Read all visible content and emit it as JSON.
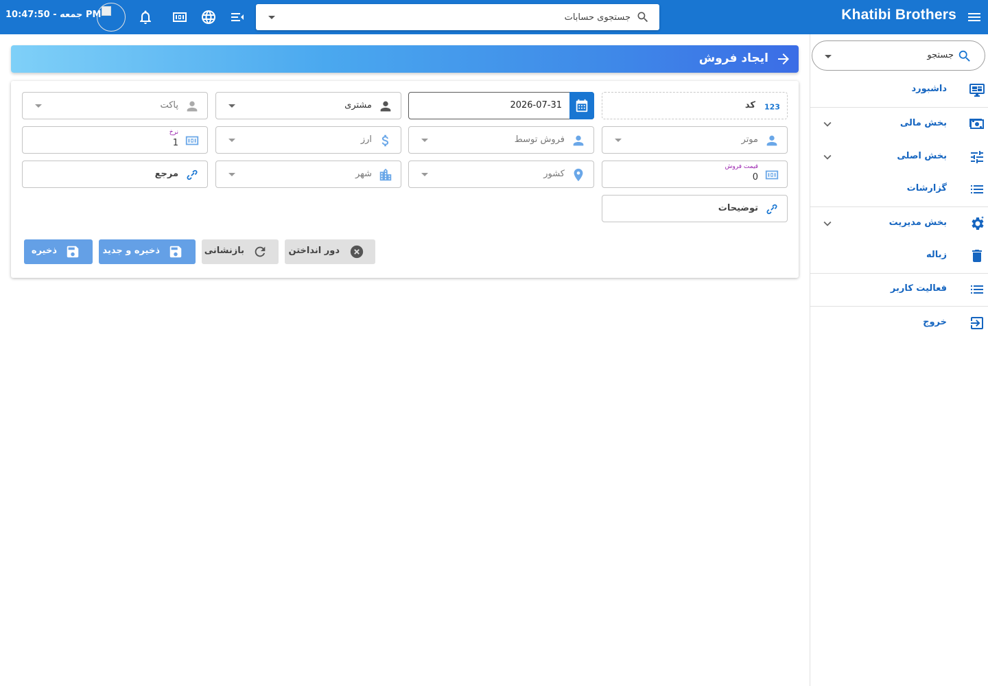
{
  "topbar": {
    "brand": "Khatibi Brothers",
    "search_placeholder": "جستجوی حسابات",
    "clock": "جمعه - 10:47:50 PM"
  },
  "sidebar": {
    "search_label": "جستجو",
    "items": [
      {
        "label": "داشبورد",
        "icon": "monitor-dashboard-icon",
        "expandable": false
      },
      {
        "label": "بخش مالی",
        "icon": "cash-icon",
        "expandable": true
      },
      {
        "label": "بخش اصلی",
        "icon": "tune-icon",
        "expandable": true
      },
      {
        "label": "گزارشات",
        "icon": "list-icon",
        "expandable": false
      },
      {
        "label": "بخش مدیریت",
        "icon": "cog-icon",
        "expandable": true
      },
      {
        "label": "زباله",
        "icon": "trash-icon",
        "expandable": false
      },
      {
        "label": "فعالیت کاربر",
        "icon": "list-icon",
        "expandable": false
      },
      {
        "label": "خروج",
        "icon": "logout-icon",
        "expandable": false
      }
    ]
  },
  "page": {
    "title": "ایجاد فروش"
  },
  "form": {
    "code_label": "کد",
    "date_value": "2026-07-31",
    "customer_label": "مشتری",
    "package_label": "پاکت",
    "vehicle_label": "موتر",
    "sold_by_label": "فروش توسط",
    "currency_label": "ارز",
    "rate_label": "نرخ",
    "rate_value": "1",
    "sale_price_label": "قیمت فروش",
    "sale_price_value": "0",
    "country_label": "کشور",
    "city_label": "شهر",
    "reference_label": "مرجع",
    "description_label": "توضیحات"
  },
  "buttons": {
    "discard": "دور انداختن",
    "reset": "بازنشانی",
    "save_new": "ذخیره و جدید",
    "save": "ذخیره"
  },
  "colors": {
    "primary": "#1976d2",
    "nav_text": "#1565c0",
    "button_blue": "#64a0e6",
    "button_grey": "#e0e0e0",
    "label_purple": "#9c27b0"
  }
}
